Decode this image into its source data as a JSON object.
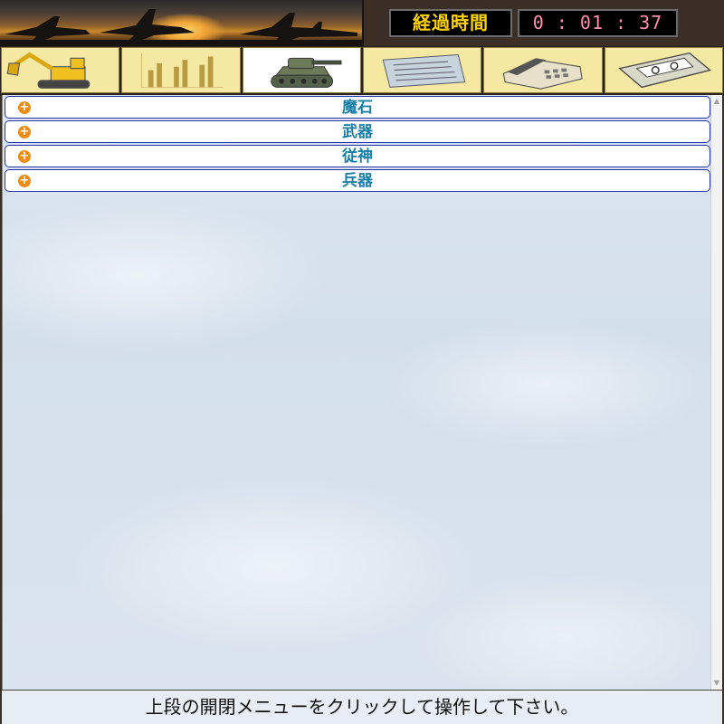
{
  "header": {
    "timer_label": "経過時間",
    "timer_value": "0 : 01 : 37"
  },
  "toolbar": {
    "buttons": [
      {
        "icon": "excavator-icon",
        "active": false
      },
      {
        "icon": "chart-table-icon",
        "active": false
      },
      {
        "icon": "tank-icon",
        "active": true
      },
      {
        "icon": "newspaper-icon",
        "active": false
      },
      {
        "icon": "telephone-icon",
        "active": false
      },
      {
        "icon": "cassette-tape-icon",
        "active": false
      }
    ]
  },
  "menu": {
    "items": [
      {
        "label": "魔石"
      },
      {
        "label": "武器"
      },
      {
        "label": "従神"
      },
      {
        "label": "兵器"
      }
    ]
  },
  "footer": {
    "message": "上段の開閉メニューをクリックして操作して下さい。"
  },
  "colors": {
    "timer_label_text": "#ffd200",
    "timer_value_text": "#ff8fb0",
    "menu_label": "#1a7fa8",
    "menu_plus": "#f08c14",
    "menu_border": "#2233aa",
    "toolbar_bg": "#f4e8a2"
  }
}
